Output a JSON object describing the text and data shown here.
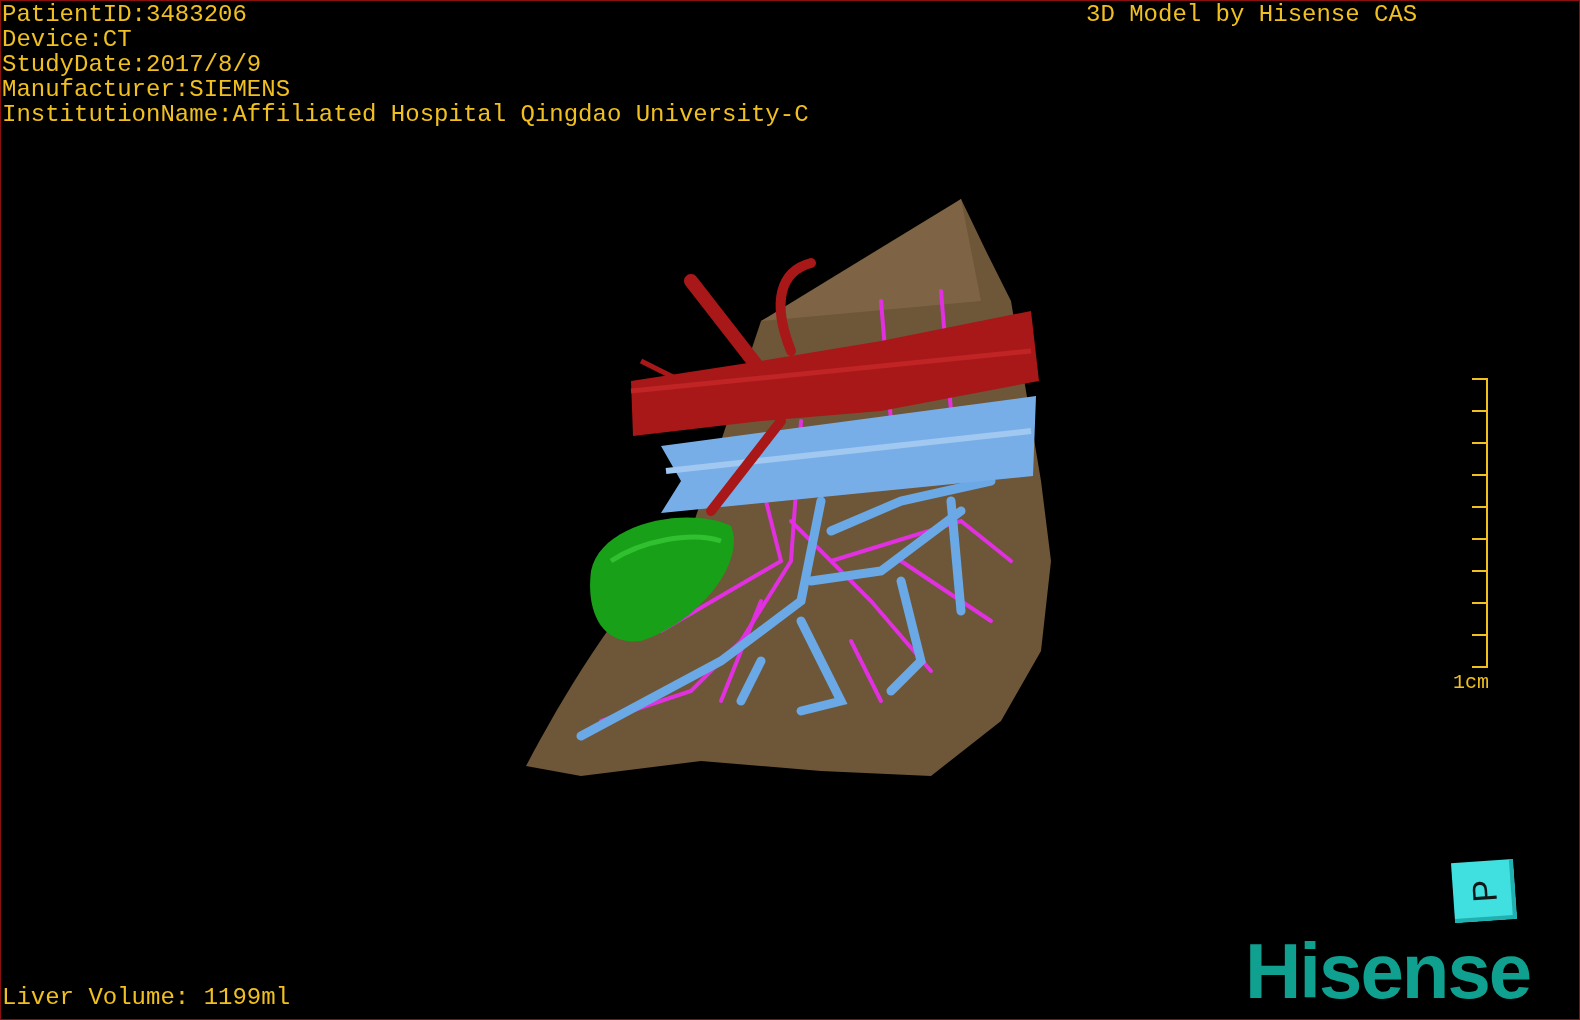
{
  "info_lines": [
    "PatientID:3483206",
    "Device:CT",
    "StudyDate:2017/8/9",
    "Manufacturer:SIEMENS",
    "InstitutionName:Affiliated Hospital Qingdao University-C"
  ],
  "title": "3D Model by Hisense CAS",
  "scale_bar": {
    "label": "1cm"
  },
  "orientation_marker": {
    "label": "P"
  },
  "liver_volume": "Liver Volume: 1199ml",
  "logo": "Hisense"
}
